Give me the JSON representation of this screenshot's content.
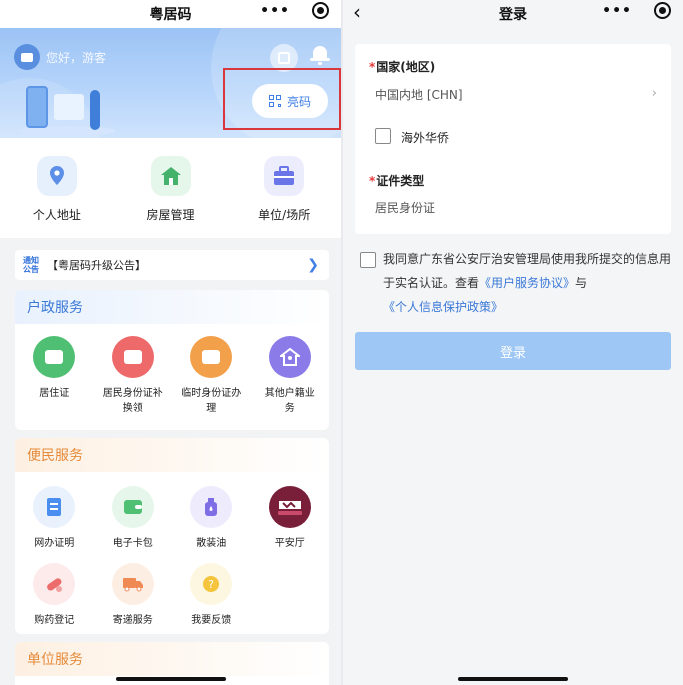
{
  "left": {
    "title": "粤居码",
    "greeting": "您好，游客",
    "liangma_label": "亮码",
    "quick": [
      {
        "label": "个人地址",
        "icon": "location-pin-icon",
        "color": "#5b8fe8",
        "bg": "#e6effc"
      },
      {
        "label": "房屋管理",
        "icon": "house-icon",
        "color": "#45b26b",
        "bg": "#e5f6ea"
      },
      {
        "label": "单位/场所",
        "icon": "briefcase-icon",
        "color": "#6a76e8",
        "bg": "#ebedfc"
      }
    ],
    "notice": {
      "tag": "通知公告",
      "text": "【粤居码升级公告】"
    },
    "huzheng": {
      "title": "户政服务",
      "items": [
        {
          "label": "居住证",
          "icon": "residence-card-icon",
          "color": "#4fbf73"
        },
        {
          "label": "居民身份证补换领",
          "icon": "id-card-icon",
          "color": "#ee6a6a"
        },
        {
          "label": "临时身份证办理",
          "icon": "temp-id-icon",
          "color": "#f2a04a"
        },
        {
          "label": "其他户籍业务",
          "icon": "household-icon",
          "color": "#8a7be8"
        }
      ]
    },
    "bianmin": {
      "title": "便民服务",
      "items": [
        {
          "label": "网办证明",
          "icon": "certificate-icon",
          "color": "#4a8ff0"
        },
        {
          "label": "电子卡包",
          "icon": "wallet-icon",
          "color": "#4fbf73"
        },
        {
          "label": "散装油",
          "icon": "oil-bottle-icon",
          "color": "#7d6ee6"
        },
        {
          "label": "平安厅",
          "icon": "ping-an-ting-logo-icon",
          "color": "#7a1f3a"
        },
        {
          "label": "购药登记",
          "icon": "pill-icon",
          "color": "#ec6b6b"
        },
        {
          "label": "寄递服务",
          "icon": "delivery-truck-icon",
          "color": "#f08a55"
        },
        {
          "label": "我要反馈",
          "icon": "feedback-icon",
          "color": "#f3c43c"
        }
      ]
    },
    "danwei": {
      "title": "单位服务"
    }
  },
  "right": {
    "title": "登录",
    "country_label": "国家(地区)",
    "country_value": "中国内地 [CHN]",
    "overseas_label": "海外华侨",
    "id_type_label": "证件类型",
    "id_type_value": "居民身份证",
    "agree_prefix": "我同意广东省公安厅治安管理局使用我所提交的信息用于实名认证。查看",
    "agree_link1": "《用户服务协议》",
    "agree_mid": "与",
    "agree_link2": "《个人信息保护政策》",
    "login_label": "登录"
  }
}
